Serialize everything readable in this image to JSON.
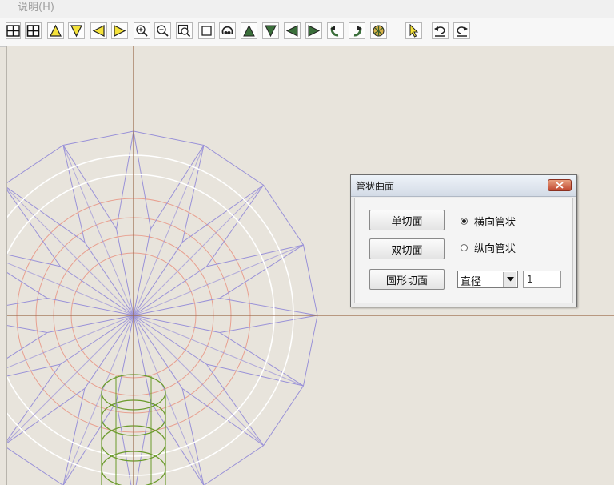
{
  "menubar": {
    "help": "说明(H)"
  },
  "toolbar": {
    "buttons": [
      {
        "id": "grid-4",
        "icon": "grid-icon"
      },
      {
        "id": "grid-4b",
        "icon": "grid-plus-icon"
      },
      {
        "id": "up",
        "icon": "triangle-up-icon"
      },
      {
        "id": "down",
        "icon": "triangle-down-icon"
      },
      {
        "id": "left",
        "icon": "triangle-left-icon"
      },
      {
        "id": "right",
        "icon": "triangle-right-icon"
      },
      {
        "id": "zoom-in",
        "icon": "zoom-in-icon"
      },
      {
        "id": "zoom-out",
        "icon": "zoom-out-icon"
      },
      {
        "id": "zoom-window",
        "icon": "zoom-window-icon"
      },
      {
        "id": "frame",
        "icon": "square-icon"
      },
      {
        "id": "rotate-view",
        "icon": "rotate-view-icon"
      },
      {
        "id": "tri-up2",
        "icon": "triangle-up-solid-icon"
      },
      {
        "id": "tri-down2",
        "icon": "triangle-down-solid-icon"
      },
      {
        "id": "tri-left2",
        "icon": "triangle-left-solid-icon"
      },
      {
        "id": "tri-right2",
        "icon": "triangle-right-solid-icon"
      },
      {
        "id": "rot-left",
        "icon": "rotate-left-icon"
      },
      {
        "id": "rot-right",
        "icon": "rotate-right-icon"
      },
      {
        "id": "render",
        "icon": "render-icon"
      },
      {
        "id": "select",
        "icon": "cursor-icon"
      },
      {
        "id": "undo",
        "icon": "undo-icon"
      },
      {
        "id": "redo",
        "icon": "redo-icon"
      }
    ]
  },
  "dialog": {
    "title": "管状曲面",
    "buttons": {
      "single": "单切面",
      "double": "双切面",
      "circle": "圆形切面"
    },
    "radios": {
      "horizontal": "横向管状",
      "vertical": "纵向管状"
    },
    "select_value": "直径",
    "input_value": "1"
  },
  "colors": {
    "background": "#e8e4dc",
    "axis": "#9a6a4a",
    "outer_mesh": "#9a92d8",
    "white_rings": "#ffffff",
    "orange_rings": "#e8a090",
    "green_tube": "#6a9a2a"
  }
}
